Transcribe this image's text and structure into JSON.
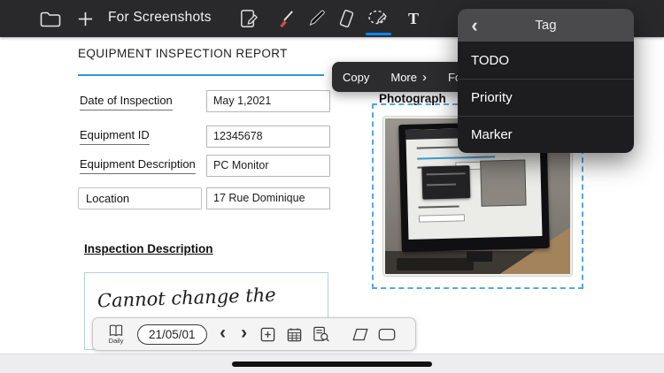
{
  "colors": {
    "toolbar_bg": "#29292b",
    "accent_blue": "#0a84ff",
    "rule_blue": "#2f98d4",
    "selection_blue": "#58a6dd",
    "popup_header": "#4a4a4c",
    "popup_body": "#1d1d1f"
  },
  "top_toolbar": {
    "title": "For Screenshots",
    "text_tool_glyph": "T"
  },
  "tag_menu": {
    "back_glyph": "‹",
    "title": "Tag",
    "items": [
      "TODO",
      "Priority",
      "Marker"
    ]
  },
  "context_menu": {
    "copy_label": "Copy",
    "more_label": "More",
    "more_chevron": "›",
    "partial_label": "For"
  },
  "document": {
    "title": "EQUIPMENT INSPECTION REPORT",
    "fields": [
      {
        "label": "Date of Inspection",
        "value": "May 1,2021"
      },
      {
        "label": "Equipment ID",
        "value": "12345678"
      },
      {
        "label": "Equipment Description",
        "value": "PC Monitor"
      },
      {
        "label": "Location",
        "value": "17 Rue Dominique"
      }
    ],
    "section_title": "Inspection Description",
    "handwriting_text": "Cannot change the",
    "photo_label": "Photograph"
  },
  "bottom_toolbar": {
    "daily_label": "Daily",
    "date_value": "21/05/01",
    "prev_glyph": "‹",
    "next_glyph": "›"
  }
}
